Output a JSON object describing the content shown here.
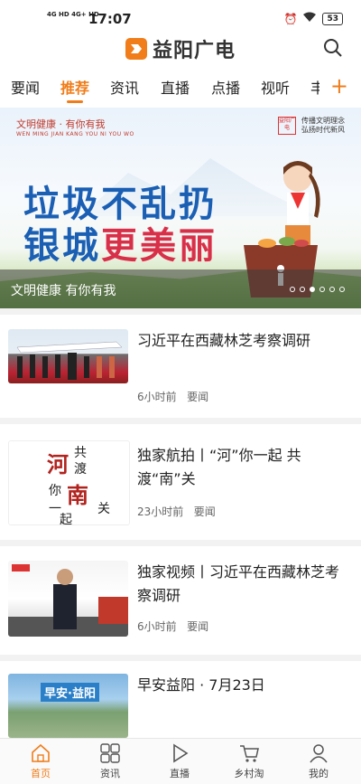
{
  "status": {
    "signal": "4G HD 4G+ HD",
    "time": "17:07",
    "battery": "53"
  },
  "brand": {
    "name": "益阳广电"
  },
  "tabs": [
    {
      "label": "要闻"
    },
    {
      "label": "推荐",
      "active": true
    },
    {
      "label": "资讯"
    },
    {
      "label": "直播"
    },
    {
      "label": "点播"
    },
    {
      "label": "视听"
    },
    {
      "label": "丰"
    }
  ],
  "banner": {
    "topleft": "文明健康 · 有你有我",
    "topleft_small": "WEN MING JIAN KANG  YOU NI YOU WO",
    "topright_seal": "益阳广电",
    "topright_lines": [
      "传播文明理念",
      "弘扬时代新风"
    ],
    "slogan1": "垃圾不乱扔",
    "slogan2a": "银城",
    "slogan2b": "更美丽",
    "caption": "文明健康 有你有我",
    "dots_count": 6,
    "active_dot": 2
  },
  "news": [
    {
      "title": "习近平在西藏林芝考察调研",
      "time": "6小时前",
      "category": "要闻"
    },
    {
      "title": "独家航拍丨“河”你一起 共渡“南”关",
      "time": "23小时前",
      "category": "要闻",
      "thumb_text": [
        "河",
        "共",
        "渡",
        "你",
        "南",
        "一",
        "起",
        "关"
      ]
    },
    {
      "title": "独家视频丨习近平在西藏林芝考察调研",
      "time": "6小时前",
      "category": "要闻"
    },
    {
      "title": "早安益阳 · 7月23日",
      "thumb_text": "早安·益阳"
    }
  ],
  "navbar": [
    {
      "label": "首页",
      "icon": "home-icon",
      "active": true
    },
    {
      "label": "资讯",
      "icon": "grid-icon"
    },
    {
      "label": "直播",
      "icon": "play-icon"
    },
    {
      "label": "乡村淘",
      "icon": "cart-icon"
    },
    {
      "label": "我的",
      "icon": "user-icon"
    }
  ],
  "colors": {
    "accent": "#f07d1a",
    "slogan_blue": "#1a5fb4",
    "slogan_red": "#d9304a"
  }
}
